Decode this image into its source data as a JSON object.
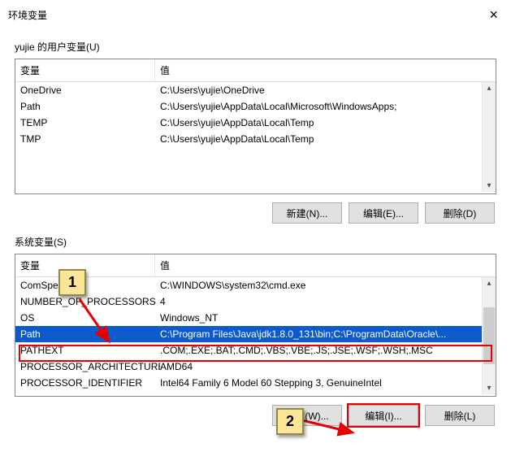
{
  "window": {
    "title": "环境变量"
  },
  "user_section": {
    "label": "yujie 的用户变量(U)",
    "headers": {
      "variable": "变量",
      "value": "值"
    },
    "rows": [
      {
        "variable": "OneDrive",
        "value": "C:\\Users\\yujie\\OneDrive"
      },
      {
        "variable": "Path",
        "value": "C:\\Users\\yujie\\AppData\\Local\\Microsoft\\WindowsApps;"
      },
      {
        "variable": "TEMP",
        "value": "C:\\Users\\yujie\\AppData\\Local\\Temp"
      },
      {
        "variable": "TMP",
        "value": "C:\\Users\\yujie\\AppData\\Local\\Temp"
      }
    ],
    "buttons": {
      "new": "新建(N)...",
      "edit": "编辑(E)...",
      "delete": "删除(D)"
    }
  },
  "system_section": {
    "label": "系统变量(S)",
    "headers": {
      "variable": "变量",
      "value": "值"
    },
    "rows": [
      {
        "variable": "ComSpec",
        "value": "C:\\WINDOWS\\system32\\cmd.exe"
      },
      {
        "variable": "NUMBER_OF_PROCESSORS",
        "value": "4"
      },
      {
        "variable": "OS",
        "value": "Windows_NT"
      },
      {
        "variable": "Path",
        "value": "C:\\Program Files\\Java\\jdk1.8.0_131\\bin;C:\\ProgramData\\Oracle\\..."
      },
      {
        "variable": "PATHEXT",
        "value": ".COM;.EXE;.BAT;.CMD;.VBS;.VBE;.JS;.JSE;.WSF;.WSH;.MSC"
      },
      {
        "variable": "PROCESSOR_ARCHITECTURE",
        "value": "AMD64"
      },
      {
        "variable": "PROCESSOR_IDENTIFIER",
        "value": "Intel64 Family 6 Model 60 Stepping 3, GenuineIntel"
      }
    ],
    "selected_index": 3,
    "buttons": {
      "new": "新建(W)...",
      "edit": "编辑(I)...",
      "delete": "删除(L)"
    }
  },
  "callouts": {
    "one": "1",
    "two": "2"
  }
}
